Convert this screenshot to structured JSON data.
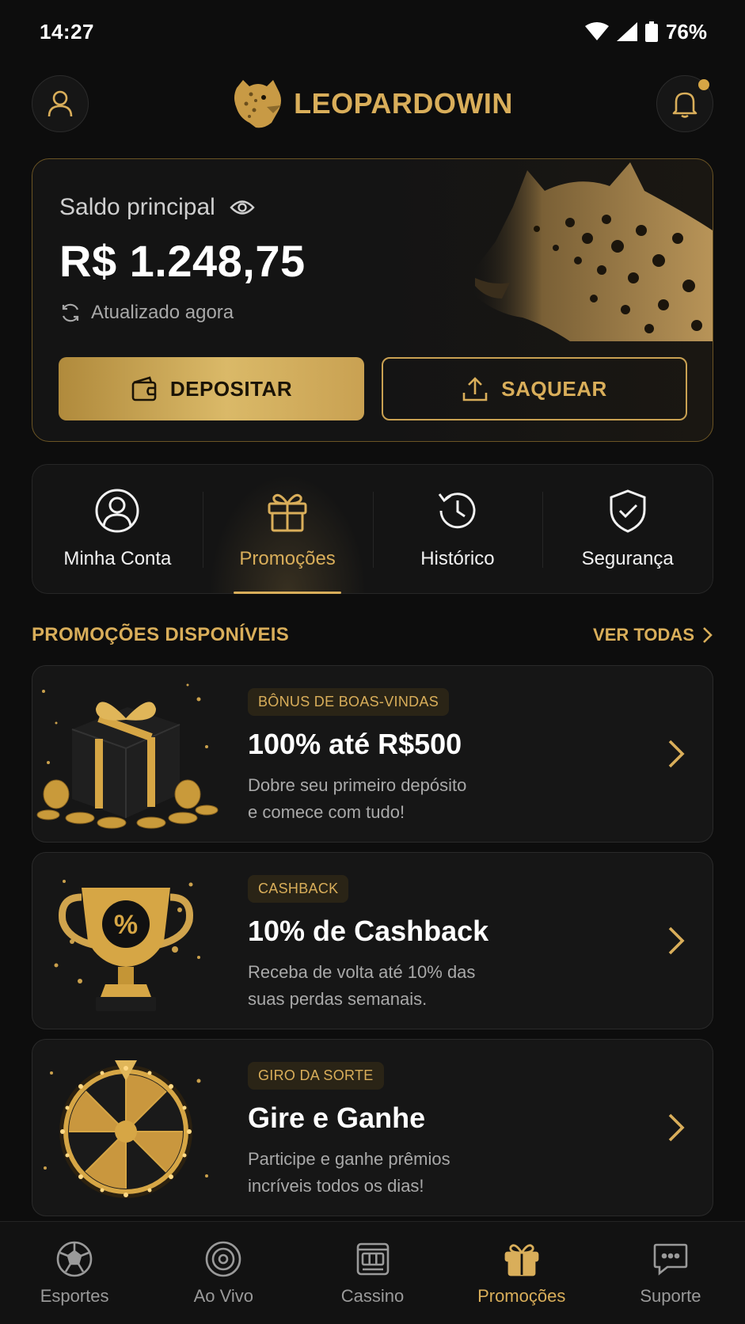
{
  "status": {
    "time": "14:27",
    "battery": "76%"
  },
  "header": {
    "brand": "LEOPARDOWIN"
  },
  "balance": {
    "label": "Saldo principal",
    "value": "R$ 1.248,75",
    "updated": "Atualizado agora",
    "deposit_label": "DEPOSITAR",
    "withdraw_label": "SAQUEAR"
  },
  "quick_nav": [
    {
      "label": "Minha Conta",
      "icon": "user-circle-icon"
    },
    {
      "label": "Promoções",
      "icon": "gift-icon",
      "active": true
    },
    {
      "label": "Histórico",
      "icon": "history-icon"
    },
    {
      "label": "Segurança",
      "icon": "shield-check-icon"
    }
  ],
  "promotions": {
    "title": "PROMOÇÕES DISPONÍVEIS",
    "see_all": "VER TODAS",
    "items": [
      {
        "badge": "BÔNUS DE BOAS-VINDAS",
        "title": "100% até R$500",
        "desc_line1": "Dobre seu primeiro depósito",
        "desc_line2": "e comece com tudo!"
      },
      {
        "badge": "CASHBACK",
        "title": "10% de Cashback",
        "desc_line1": "Receba de volta até 10% das",
        "desc_line2": "suas perdas semanais."
      },
      {
        "badge": "GIRO DA SORTE",
        "title": "Gire e Ganhe",
        "desc_line1": "Participe e ganhe prêmios",
        "desc_line2": "incríveis todos os dias!"
      }
    ]
  },
  "bottom_nav": [
    {
      "label": "Esportes",
      "icon": "soccer-ball-icon"
    },
    {
      "label": "Ao Vivo",
      "icon": "live-broadcast-icon"
    },
    {
      "label": "Cassino",
      "icon": "slot-machine-icon"
    },
    {
      "label": "Promoções",
      "icon": "gift-icon",
      "active": true
    },
    {
      "label": "Suporte",
      "icon": "chat-support-icon"
    }
  ],
  "colors": {
    "accent": "#d9ae5a",
    "background": "#0d0d0d",
    "card": "#161616"
  }
}
